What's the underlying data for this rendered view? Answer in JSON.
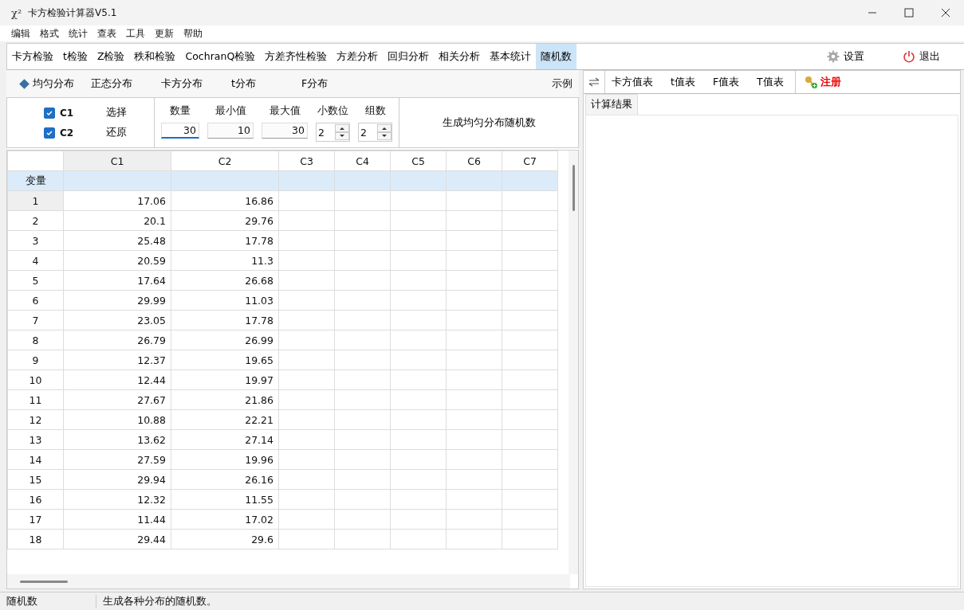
{
  "window": {
    "logo": "χ²",
    "title": "卡方检验计算器V5.1"
  },
  "menu": [
    "编辑",
    "格式",
    "统计",
    "查表",
    "工具",
    "更新",
    "帮助"
  ],
  "tabs": [
    {
      "label": "卡方检验",
      "selected": false
    },
    {
      "label": "t检验",
      "selected": false
    },
    {
      "label": "Z检验",
      "selected": false
    },
    {
      "label": "秩和检验",
      "selected": false
    },
    {
      "label": "CochranQ检验",
      "selected": false
    },
    {
      "label": "方差齐性检验",
      "selected": false
    },
    {
      "label": "方差分析",
      "selected": false
    },
    {
      "label": "回归分析",
      "selected": false
    },
    {
      "label": "相关分析",
      "selected": false
    },
    {
      "label": "基本统计",
      "selected": false
    },
    {
      "label": "随机数",
      "selected": true
    }
  ],
  "toolbar_right": {
    "settings": "设置",
    "exit": "退出"
  },
  "distributions": [
    {
      "label": "均匀分布",
      "selected": true
    },
    {
      "label": "正态分布",
      "selected": false
    },
    {
      "label": "卡方分布",
      "selected": false
    },
    {
      "label": "t分布",
      "selected": false
    },
    {
      "label": "F分布",
      "selected": false
    }
  ],
  "example_link": "示例",
  "variables": [
    {
      "label": "C1",
      "checked": true
    },
    {
      "label": "C2",
      "checked": true
    }
  ],
  "select_button": "选择",
  "restore_button": "还原",
  "params": [
    {
      "label": "数量",
      "value": "30",
      "kind": "field",
      "focused": true
    },
    {
      "label": "最小值",
      "value": "10",
      "kind": "field",
      "focused": false
    },
    {
      "label": "最大值",
      "value": "30",
      "kind": "field",
      "focused": false
    },
    {
      "label": "小数位",
      "value": "2",
      "kind": "spinner"
    },
    {
      "label": "组数",
      "value": "2",
      "kind": "spinner"
    }
  ],
  "generate_button": "生成均匀分布随机数",
  "table": {
    "corner_label": "变量",
    "columns": [
      {
        "label": "C1",
        "selected": true
      },
      {
        "label": "C2",
        "selected": false
      },
      {
        "label": "C3",
        "selected": false
      },
      {
        "label": "C4",
        "selected": false
      },
      {
        "label": "C5",
        "selected": false
      },
      {
        "label": "C6",
        "selected": false
      },
      {
        "label": "C7",
        "selected": false
      }
    ],
    "rows": [
      {
        "label": "1",
        "selected": true,
        "cells": [
          "17.06",
          "16.86"
        ]
      },
      {
        "label": "2",
        "selected": false,
        "cells": [
          "20.1",
          "29.76"
        ]
      },
      {
        "label": "3",
        "selected": false,
        "cells": [
          "25.48",
          "17.78"
        ]
      },
      {
        "label": "4",
        "selected": false,
        "cells": [
          "20.59",
          "11.3"
        ]
      },
      {
        "label": "5",
        "selected": false,
        "cells": [
          "17.64",
          "26.68"
        ]
      },
      {
        "label": "6",
        "selected": false,
        "cells": [
          "29.99",
          "11.03"
        ]
      },
      {
        "label": "7",
        "selected": false,
        "cells": [
          "23.05",
          "17.78"
        ]
      },
      {
        "label": "8",
        "selected": false,
        "cells": [
          "26.79",
          "26.99"
        ]
      },
      {
        "label": "9",
        "selected": false,
        "cells": [
          "12.37",
          "19.65"
        ]
      },
      {
        "label": "10",
        "selected": false,
        "cells": [
          "12.44",
          "19.97"
        ]
      },
      {
        "label": "11",
        "selected": false,
        "cells": [
          "27.67",
          "21.86"
        ]
      },
      {
        "label": "12",
        "selected": false,
        "cells": [
          "10.88",
          "22.21"
        ]
      },
      {
        "label": "13",
        "selected": false,
        "cells": [
          "13.62",
          "27.14"
        ]
      },
      {
        "label": "14",
        "selected": false,
        "cells": [
          "27.59",
          "19.96"
        ]
      },
      {
        "label": "15",
        "selected": false,
        "cells": [
          "29.94",
          "26.16"
        ]
      },
      {
        "label": "16",
        "selected": false,
        "cells": [
          "12.32",
          "11.55"
        ]
      },
      {
        "label": "17",
        "selected": false,
        "cells": [
          "11.44",
          "17.02"
        ]
      },
      {
        "label": "18",
        "selected": false,
        "cells": [
          "29.44",
          "29.6"
        ]
      }
    ]
  },
  "table_tools": [
    "卡方值表",
    "t值表",
    "F值表",
    "T值表"
  ],
  "register": "注册",
  "result_tabs": [
    {
      "label": "计算结果",
      "selected": true
    }
  ],
  "status_bar": [
    "随机数",
    "生成各种分布的随机数。"
  ]
}
